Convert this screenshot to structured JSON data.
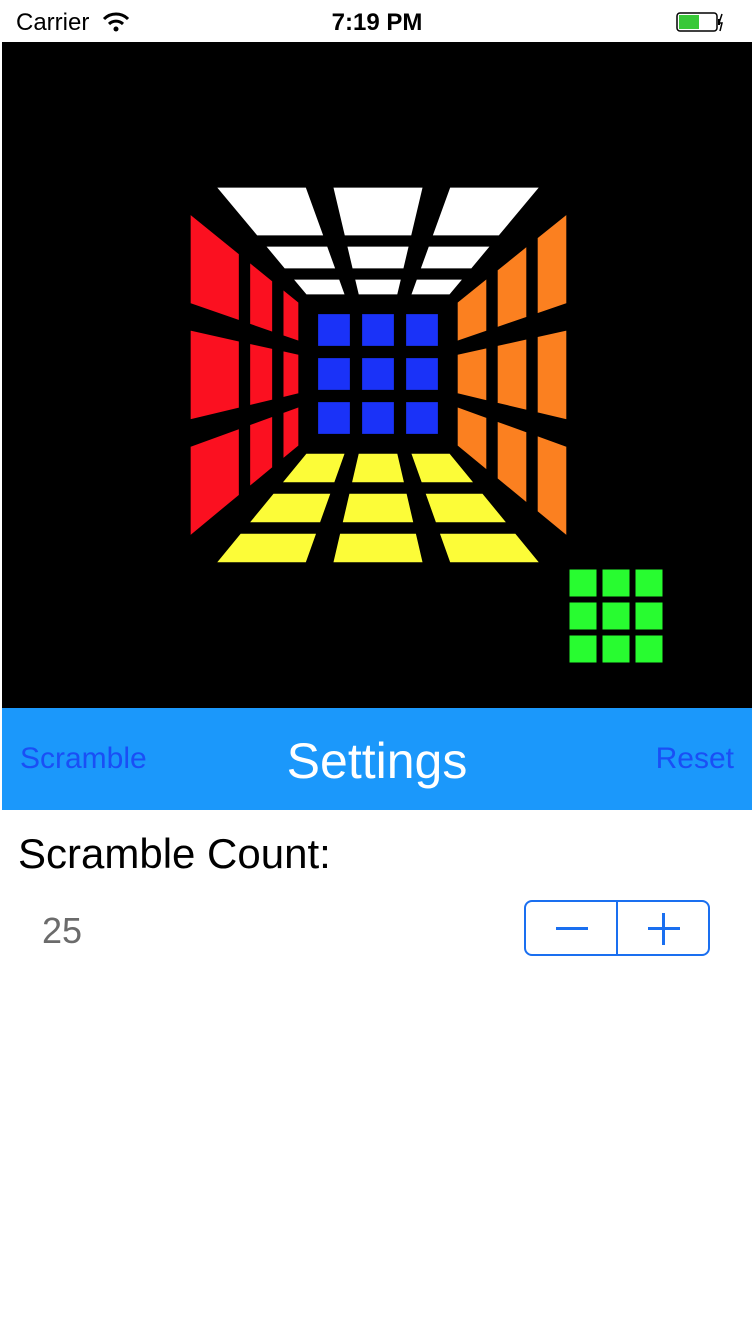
{
  "status_bar": {
    "carrier": "Carrier",
    "time": "7:19 PM"
  },
  "cube_colors": {
    "top": "#ffffff",
    "left": "#fb1020",
    "right": "#fb8020",
    "back": "#1a32f8",
    "bottom": "#fcfc38",
    "mini": "#28fc30"
  },
  "nav": {
    "left": "Scramble",
    "title": "Settings",
    "right": "Reset"
  },
  "settings": {
    "scramble_count_label": "Scramble Count:",
    "scramble_count_value": "25"
  },
  "accent_color": "#1b98fb"
}
